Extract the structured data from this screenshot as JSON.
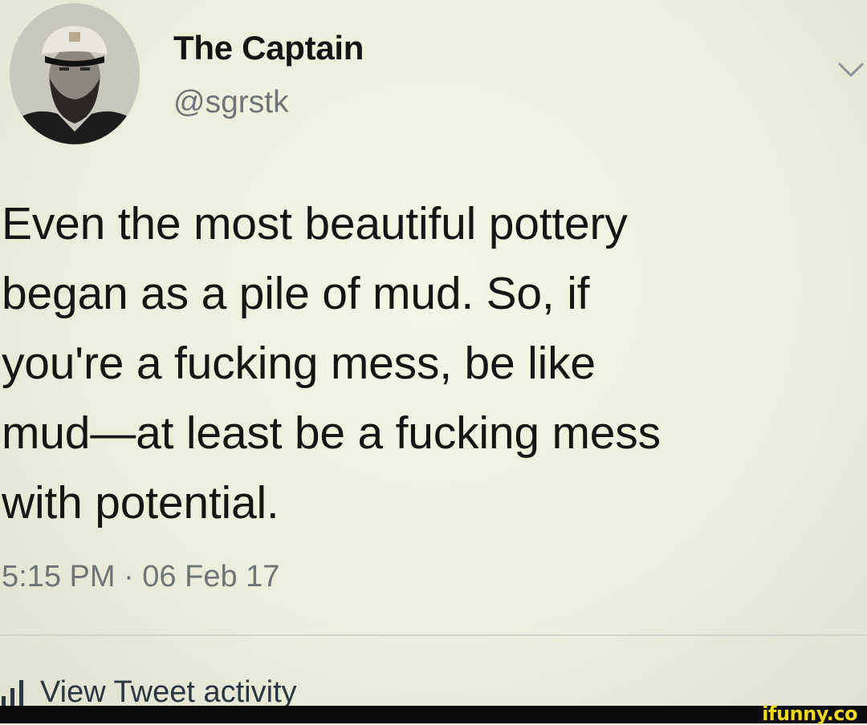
{
  "author": {
    "display_name": "The Captain",
    "handle": "@sgrstk",
    "avatar_icon": "captain-avatar"
  },
  "menu": {
    "icon": "chevron-down-icon"
  },
  "tweet": {
    "text": "Even the most beautiful pottery\nbegan as a pile of mud. So, if\nyou're a fucking mess, be like\nmud—at least be a fucking mess\nwith potential.",
    "timestamp": "5:15 PM · 06 Feb 17"
  },
  "activity": {
    "icon": "bar-chart-icon",
    "label": "View Tweet activity"
  },
  "watermark": {
    "text": "ifunny.co",
    "color": "#f0d81c"
  },
  "colors": {
    "background": "#efefdf",
    "text": "#151515",
    "muted": "#6f7478",
    "link": "#2b3642"
  }
}
